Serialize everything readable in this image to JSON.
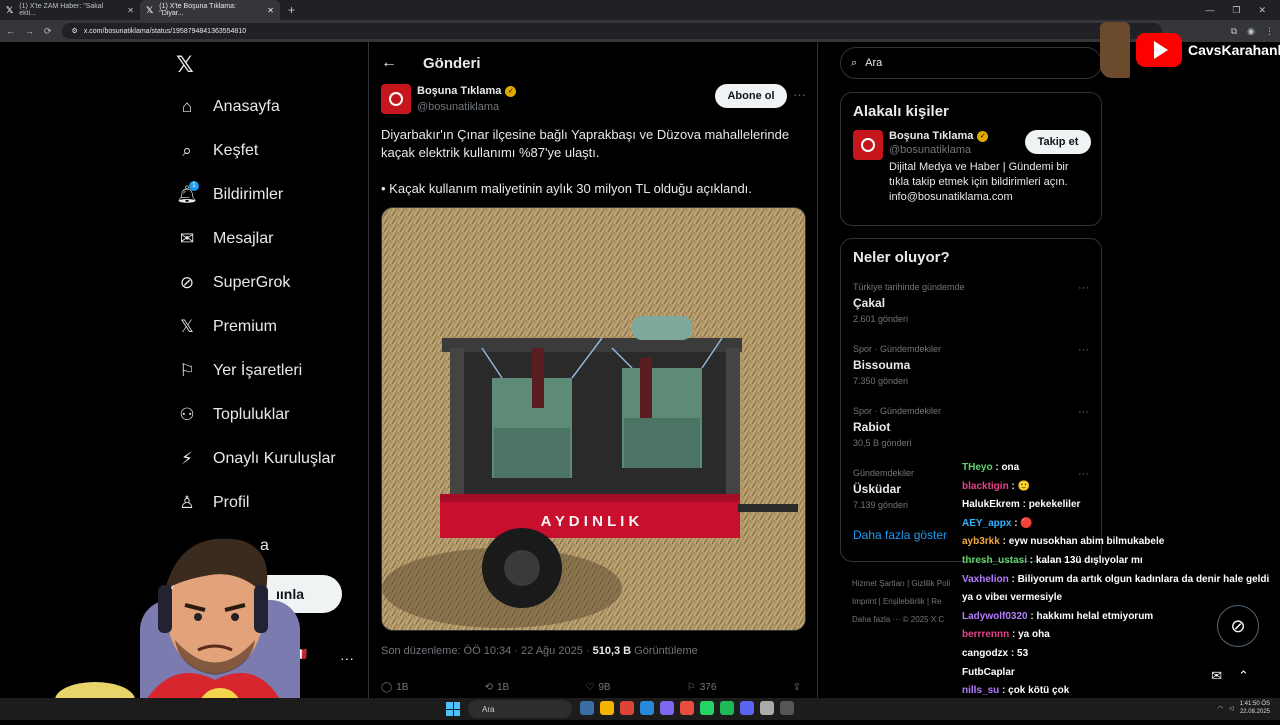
{
  "browser": {
    "tabs": [
      {
        "title": "(1) X'te ZAM Haber: \"Sakal ekti...",
        "active": false
      },
      {
        "title": "(1) X'te Boşuna Tıklama: \"Diyar...",
        "active": true
      }
    ],
    "url": "x.com/bosunatiklama/status/1958794841363554810"
  },
  "nav": {
    "items": [
      {
        "label": "Anasayfa",
        "icon": "home-icon"
      },
      {
        "label": "Keşfet",
        "icon": "search-icon"
      },
      {
        "label": "Bildirimler",
        "icon": "bell-icon",
        "badge": "1"
      },
      {
        "label": "Mesajlar",
        "icon": "mail-icon"
      },
      {
        "label": "SuperGrok",
        "icon": "grok-icon"
      },
      {
        "label": "Premium",
        "icon": "x-icon"
      },
      {
        "label": "Yer İşaretleri",
        "icon": "bookmark-icon"
      },
      {
        "label": "Topluluklar",
        "icon": "people-icon"
      },
      {
        "label": "Onaylı Kuruluşlar",
        "icon": "lightning-icon"
      },
      {
        "label": "Profil",
        "icon": "person-icon"
      },
      {
        "label": "a",
        "icon": "more-circle-icon"
      }
    ],
    "post_label": "ıınla",
    "profile_name": "nli 🇮🇹"
  },
  "main": {
    "title": "Gönderi",
    "author_name": "Boşuna Tıklama",
    "author_handle": "@bosunatiklama",
    "subscribe_label": "Abone ol",
    "text_1": "Diyarbakır'ın Çınar ilçesine bağlı Yaprakbaşı ve Düzova mahallelerinde kaçak elektrik kullanımı %87'ye ulaştı.",
    "text_2": "• Kaçak kullanım maliyetinin aylık 30 milyon TL olduğu açıklandı.",
    "media_text": "A Y D I N L I K",
    "edited": "Son düzenleme: ÖÖ 10:34 · 22 Ağu 2025 · ",
    "views": "510,3 B",
    "views_label": " Görüntüleme",
    "actions": {
      "replies": "1B",
      "reposts": "1B",
      "likes": "9B",
      "bookmarks": "376"
    }
  },
  "right": {
    "search_placeholder": "Ara",
    "related_title": "Alakalı kişiler",
    "related_name": "Boşuna Tıklama",
    "related_handle": "@bosunatiklama",
    "follow_label": "Takip et",
    "related_bio": "Dijital Medya ve Haber | Gündemi bir tıkla takip etmek için bildirimleri açın. info@bosunatiklama.com",
    "trends_title": "Neler oluyor?",
    "trends": [
      {
        "context": "Türkiye tarihinde gündemde",
        "topic": "Çakal",
        "count": "2.601 gönderi"
      },
      {
        "context": "Spor · Gündemdekiler",
        "topic": "Bissouma",
        "count": "7.350 gönderi"
      },
      {
        "context": "Spor · Gündemdekiler",
        "topic": "Rabiot",
        "count": "30,5 B gönderi"
      },
      {
        "context": "Gündemdekiler",
        "topic": "Üsküdar",
        "count": "7.139 gönderi"
      }
    ],
    "show_more": "Daha fazla göster",
    "footer_1": "Hizmet Şartları  |  Gizlilik Poli",
    "footer_2": "Imprint  |  Erişilebilirlik  |  Re",
    "footer_3": "Daha fazla ···   © 2025 X C"
  },
  "overlay": {
    "channel_name": "CavsKarahanli",
    "chat": [
      {
        "user": "THeyo",
        "msg": "ona",
        "cls": "user-a"
      },
      {
        "user": "blacktigin",
        "msg": "🙂",
        "cls": "user-b"
      },
      {
        "user": "HalukEkrem",
        "msg": "pekekeliler",
        "cls": "user-c"
      },
      {
        "user": "AEY_appx",
        "msg": "🔴",
        "cls": "user-d"
      },
      {
        "user": "ayb3rkk",
        "msg": "eyw nusokhan abim bilmukabele",
        "cls": "user-e"
      },
      {
        "user": "thresh_ustasi",
        "msg": "kalan 13ü dışlıyolar mı",
        "cls": "user-a"
      },
      {
        "user": "Vaxhelion",
        "msg": "Biliyorum da artık olgun kadınlara da denir hale geldi ya o vibeı vermesiyle",
        "cls": "user-f"
      },
      {
        "user": "Ladywolf0320",
        "msg": "hakkımı helal etmiyorum",
        "cls": "user-f"
      },
      {
        "user": "berrrennn",
        "msg": "ya oha",
        "cls": "user-b"
      },
      {
        "user": "cangodzx",
        "msg": "53",
        "cls": "user-c"
      },
      {
        "user": "FutbCaplar",
        "msg": "",
        "cls": "user-c"
      },
      {
        "user": "nills_su",
        "msg": "çok kötü çok",
        "cls": "user-f"
      }
    ]
  },
  "taskbar": {
    "search": "Ara",
    "time": "1:41:50 ÖS",
    "date": "22.08.2025"
  }
}
